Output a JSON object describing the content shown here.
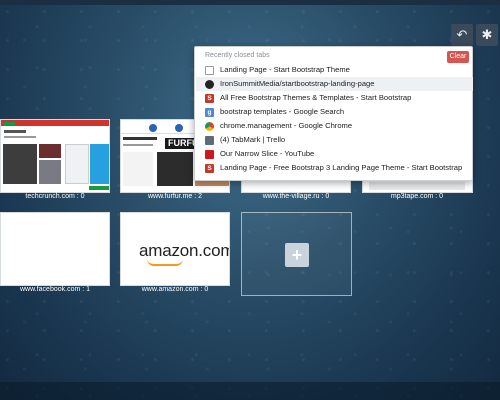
{
  "colors": {
    "clear_button": "#d9534f",
    "bootstrap_icon": "#c0392b",
    "google_icon": "#4a8bd4",
    "youtube_icon": "#cc181e",
    "trello_icon": "#5f6b78"
  },
  "toolbar": {
    "undo_icon": "undo-icon",
    "settings_icon": "gear-icon"
  },
  "tiles": [
    {
      "caption": "techcrunch.com : 0"
    },
    {
      "caption": "www.furfur.me : 2"
    },
    {
      "caption": "www.the-village.ru : 0"
    },
    {
      "caption": "mp3tape.com : 0"
    },
    {
      "caption": "www.facebook.com : 1"
    },
    {
      "caption": "www.amazon.com : 0"
    }
  ],
  "thumbs": {
    "furfur_logo": "FURFU",
    "amazon_logo": "amazon.com"
  },
  "add_tile": {
    "icon": "plus-icon",
    "symbol": "+"
  },
  "recently_closed": {
    "title": "Recently closed tabs",
    "clear_label": "Clear",
    "items": [
      {
        "label": "Landing Page - Start Bootstrap Theme",
        "icon": "blank-page-icon"
      },
      {
        "label": "IronSummitMedia/startbootstrap-landing-page",
        "icon": "github-icon"
      },
      {
        "label": "All Free Bootstrap Themes & Templates - Start Bootstrap",
        "icon": "bootstrap-icon",
        "glyph": "S"
      },
      {
        "label": "bootstrap templates - Google Search",
        "icon": "google-icon",
        "glyph": "g"
      },
      {
        "label": "chrome.management - Google Chrome",
        "icon": "chrome-icon"
      },
      {
        "label": "(4) TabMark | Trello",
        "icon": "trello-icon"
      },
      {
        "label": "Our Narrow Slice - YouTube",
        "icon": "youtube-icon"
      },
      {
        "label": "Landing Page - Free Bootstrap 3 Landing Page Theme - Start Bootstrap",
        "icon": "bootstrap-icon",
        "glyph": "S"
      }
    ]
  }
}
